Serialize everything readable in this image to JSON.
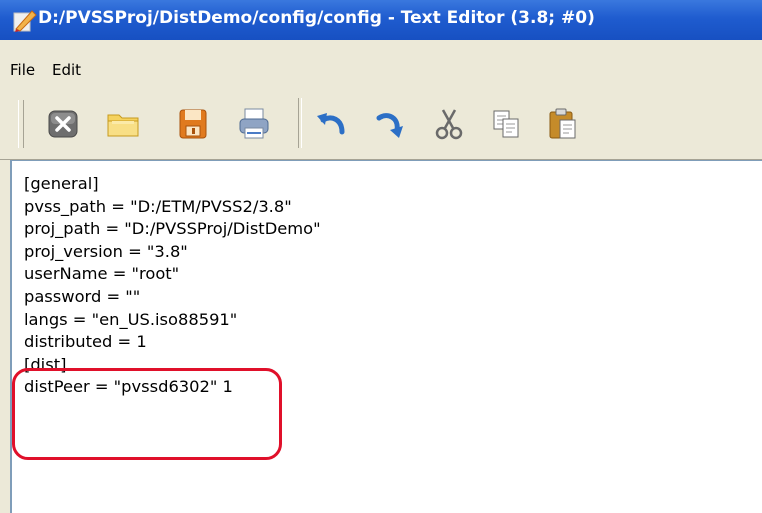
{
  "window": {
    "title": "D:/PVSSProj/DistDemo/config/config - Text Editor (3.8; #0)"
  },
  "menu": {
    "items": [
      "File",
      "Edit"
    ]
  },
  "toolbar": {
    "buttons": [
      {
        "name": "close-icon"
      },
      {
        "name": "open-folder-icon"
      },
      {
        "name": "save-icon"
      },
      {
        "name": "print-icon"
      },
      {
        "name": "undo-icon"
      },
      {
        "name": "redo-icon"
      },
      {
        "name": "cut-icon"
      },
      {
        "name": "copy-icon"
      },
      {
        "name": "paste-icon"
      }
    ]
  },
  "editor": {
    "lines": [
      "[general]",
      "pvss_path = \"D:/ETM/PVSS2/3.8\"",
      "proj_path = \"D:/PVSSProj/DistDemo\"",
      "proj_version = \"3.8\"",
      "userName = \"root\"",
      "password = \"\"",
      "langs = \"en_US.iso88591\"",
      "distributed = 1",
      "[dist]",
      "distPeer = \"pvssd6302\" 1"
    ]
  },
  "colors": {
    "titlebar": "#1f5ccf",
    "highlight": "#e0102a",
    "chrome": "#ece9d8"
  }
}
